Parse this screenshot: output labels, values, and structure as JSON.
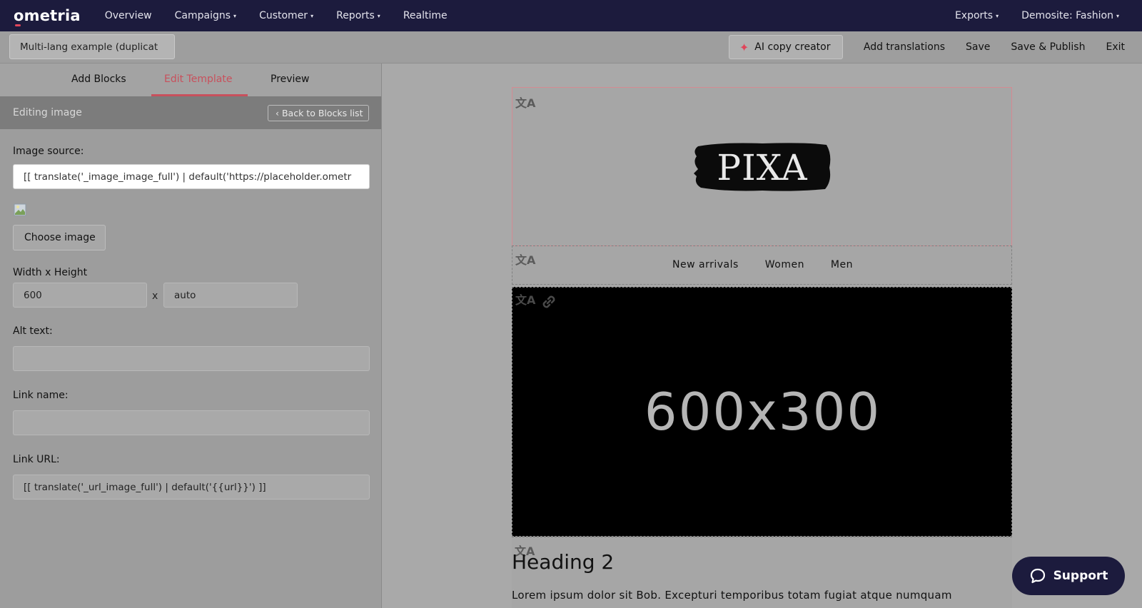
{
  "topnav": {
    "logo": "ometria",
    "items": [
      {
        "label": "Overview"
      },
      {
        "label": "Campaigns",
        "dropdown": true
      },
      {
        "label": "Customer",
        "dropdown": true
      },
      {
        "label": "Reports",
        "dropdown": true
      },
      {
        "label": "Realtime"
      }
    ],
    "right": [
      {
        "label": "Exports",
        "dropdown": true
      },
      {
        "label": "Demosite: Fashion",
        "dropdown": true
      }
    ]
  },
  "toolbar": {
    "template_name": "Multi-lang example (duplicat",
    "ai_copy_label": "AI copy creator",
    "add_translations_label": "Add translations",
    "save_label": "Save",
    "save_publish_label": "Save & Publish",
    "exit_label": "Exit"
  },
  "left_panel": {
    "tabs": [
      {
        "label": "Add Blocks",
        "active": false
      },
      {
        "label": "Edit Template",
        "active": true
      },
      {
        "label": "Preview",
        "active": false
      }
    ],
    "editing_title": "Editing image",
    "back_label": "‹ Back to Blocks list",
    "image_source_label": "Image source:",
    "image_source_value": "[[ translate('_image_image_full') | default('https://placeholder.ometr",
    "choose_image_label": "Choose image",
    "size_label": "Width x Height",
    "width_value": "600",
    "size_separator": "x",
    "height_value": "auto",
    "alt_text_label": "Alt text:",
    "alt_text_value": "",
    "link_name_label": "Link name:",
    "link_name_value": "",
    "link_url_label": "Link URL:",
    "link_url_value": "[[ translate('_url_image_full') | default('{{url}}') ]]"
  },
  "email_preview": {
    "logo_text": "PIXA",
    "menu_links": [
      "New arrivals",
      "Women",
      "Men"
    ],
    "hero_text": "600x300",
    "heading": "Heading 2",
    "body": "Lorem ipsum dolor sit Bob. Excepturi temporibus totam fugiat atque numquam"
  },
  "support_label": "Support",
  "colors": {
    "nav_bg": "#1c1b3d",
    "accent": "#c8505c",
    "ai_icon": "#e0455a"
  },
  "icons": {
    "translate": "translate-icon",
    "link": "link-icon",
    "ai": "sparkle-icon",
    "support": "chat-bubble-icon"
  }
}
